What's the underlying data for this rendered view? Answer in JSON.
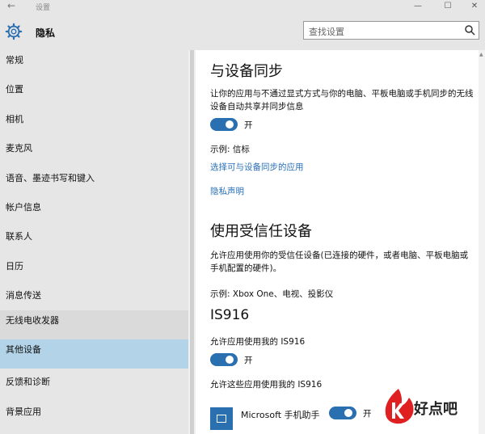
{
  "window": {
    "title": "设置"
  },
  "header": {
    "page_title": "隐私",
    "search_placeholder": "查找设置"
  },
  "sidebar": {
    "items": [
      {
        "label": "常规"
      },
      {
        "label": "位置"
      },
      {
        "label": "相机"
      },
      {
        "label": "麦克风"
      },
      {
        "label": "语音、墨迹书写和键入"
      },
      {
        "label": "帐户信息"
      },
      {
        "label": "联系人"
      },
      {
        "label": "日历"
      },
      {
        "label": "消息传送"
      },
      {
        "label": "无线电收发器"
      },
      {
        "label": "其他设备"
      },
      {
        "label": "反馈和诊断"
      },
      {
        "label": "背景应用"
      }
    ],
    "hovered_index": 9,
    "selected_index": 10
  },
  "sync": {
    "title": "与设备同步",
    "description": "让你的应用与不通过显式方式与你的电脑、平板电脑或手机同步的无线设备自动共享并同步信息",
    "toggle_state": "开",
    "example": "示例: 信标",
    "choose_apps_link": "选择可与设备同步的应用",
    "privacy_link": "隐私声明"
  },
  "trusted": {
    "title": "使用受信任设备",
    "description": "允许应用使用你的受信任设备(已连接的硬件，或者电脑、平板电脑或手机配置的硬件)。",
    "example": "示例: Xbox One、电视、投影仪"
  },
  "device": {
    "name": "IS916",
    "allow_label": "允许应用使用我的 IS916",
    "toggle_state": "开",
    "apps_label": "允许这些应用使用我的 IS916",
    "app_name": "Microsoft 手机助手",
    "app_toggle_state": "开"
  },
  "watermark": {
    "text": "好点吧"
  },
  "colors": {
    "accent": "#2a6fb0",
    "link": "#2a70b8",
    "selected_bg": "#b3d4e8",
    "chrome_bg": "#e6e6e6",
    "watermark_red": "#e02020"
  }
}
